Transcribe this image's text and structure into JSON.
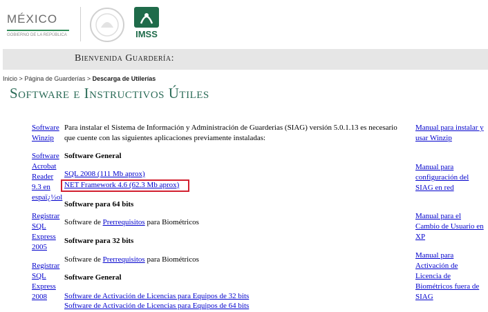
{
  "header": {
    "mexico_logo": "MÉXICO",
    "mexico_sub": "GOBIERNO DE LA REPÚBLICA",
    "imss_logo": "IMSS"
  },
  "welcome_bar": {
    "text": "Bienvenida Guardería:"
  },
  "breadcrumb": {
    "items": [
      "Inicio",
      "Página de Guarderías",
      "Descarga de Utilerías"
    ],
    "separator": ">"
  },
  "page_title": "Software e Instructivos Útiles",
  "left_links": [
    "Software Winzip",
    "Software Acrobat Reader 9.3 en espaï¿½ol",
    "Registrar SQL Express 2005",
    "Registrar SQL Express 2008"
  ],
  "main": {
    "intro": [
      "Para instalar el Sistema de Información y Administración de Guarderias (SIAG) versión 5.0.1.13 es necesario",
      "que cuente con las siguientes aplicaciones previamente instaladas:"
    ],
    "section1_title": "Software General",
    "sql2008_link": "SQL 2008 (111 Mb aprox)",
    "netfw_link": "NET Framework 4.6 (62.3 Mb aprox)",
    "section2_title": "Software para 64 bits",
    "section3_title": "Software para 32 bits",
    "software_de": "Software de",
    "prereq_link": "Prerrequisitos",
    "para_biometricos": "para Biométricos",
    "section4_title": "Software General",
    "licencias32_link": "Software de Activación de Licencias para Equipos de 32 bits",
    "licencias64_link": "Software de Activación de Licencias para Equipos de 64 bits"
  },
  "right_links": [
    "Manual para instalar y usar Winzip",
    "Manual para configuración del SIAG en red",
    "Manual para el Cambio de Usuario en XP",
    "Manual para Activación de Licencia de Biométricos fuera de SIAG"
  ],
  "colors": {
    "title": "#2b6b57",
    "link": "#0000cc",
    "highlight": "#d21f2e",
    "bar": "#e6e6e6"
  }
}
